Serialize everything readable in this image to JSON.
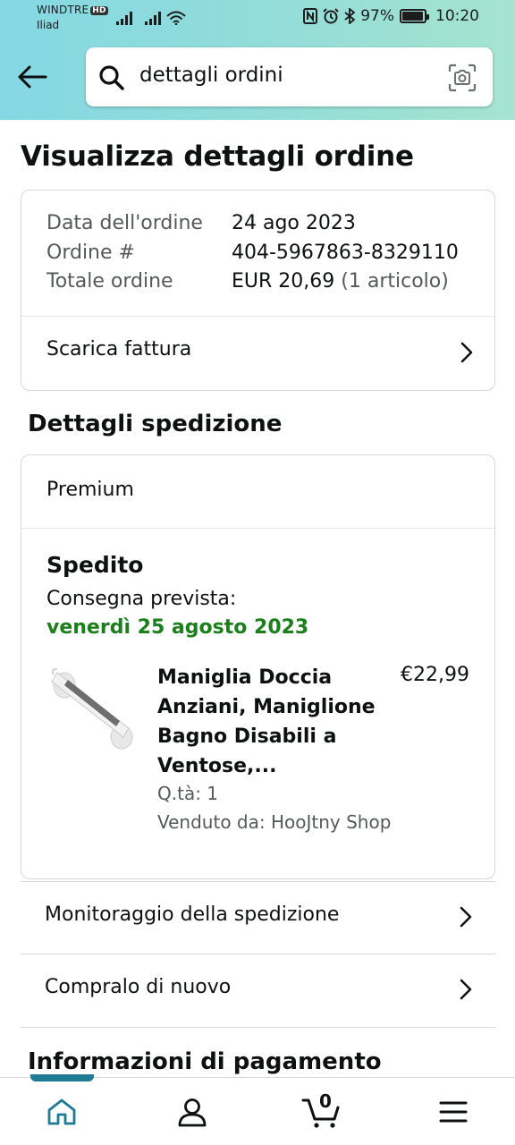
{
  "status_bar": {
    "carrier_primary": "WINDTRE",
    "hd_badge": "HD",
    "carrier_secondary": "Iliad",
    "battery_percent": "97%",
    "battery_level": 0.97,
    "time": "10:20"
  },
  "header": {
    "search": {
      "value": "dettagli ordini",
      "placeholder": ""
    }
  },
  "page": {
    "title": "Visualizza dettagli ordine"
  },
  "order_summary": {
    "rows": [
      {
        "label": "Data dell'ordine",
        "value": "24 ago 2023"
      },
      {
        "label": "Ordine #",
        "value": "404-5967863-8329110"
      },
      {
        "label": "Totale ordine",
        "value": "EUR 20,69",
        "note": "(1 articolo)"
      }
    ],
    "invoice_link": "Scarica fattura"
  },
  "shipping": {
    "section_title": "Dettagli spedizione",
    "plan": "Premium",
    "status": "Spedito",
    "delivery_label": "Consegna prevista:",
    "delivery_date": "venerdì 25 agosto 2023",
    "product": {
      "title_lines": [
        "Maniglia Doccia",
        "Anziani, Maniglione",
        "Bagno Disabili a",
        "Ventose,..."
      ],
      "price": "€22,99",
      "qty": "Q.tà: 1",
      "seller": "Venduto da: HooJtny Shop"
    }
  },
  "links": {
    "track": "Monitoraggio della spedizione",
    "buy_again": "Compralo di nuovo"
  },
  "payment": {
    "section_title": "Informazioni di pagamento"
  },
  "bottom_nav": {
    "cart_count": "0",
    "active": "home"
  },
  "colors": {
    "accent_teal": "#1f7a94",
    "delivery_green": "#1b7f1b"
  }
}
